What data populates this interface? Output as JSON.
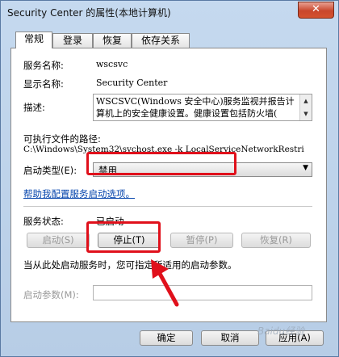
{
  "window": {
    "title": "Security Center 的属性(本地计算机)",
    "close_label": "✕"
  },
  "tabs": [
    {
      "label": "常规"
    },
    {
      "label": "登录"
    },
    {
      "label": "恢复"
    },
    {
      "label": "依存关系"
    }
  ],
  "general": {
    "service_name_label": "服务名称:",
    "service_name_value": "wscsvc",
    "display_name_label": "显示名称:",
    "display_name_value": "Security Center",
    "description_label": "描述:",
    "description_value": "WSCSVC(Windows 安全中心)服务监视并报告计\n算机上的安全健康设置。健康设置包括防火墙(",
    "exe_path_label": "可执行文件的路径:",
    "exe_path_value": "C:\\Windows\\System32\\svchost.exe -k LocalServiceNetworkRestri",
    "startup_type_label": "启动类型(E):",
    "startup_type_value": "禁用",
    "help_link": "帮助我配置服务启动选项。",
    "service_status_label": "服务状态:",
    "service_status_value": "已启动",
    "buttons": {
      "start": "启动(S)",
      "stop": "停止(T)",
      "pause": "暂停(P)",
      "resume": "恢复(R)"
    },
    "hint_text": "当从此处启动服务时，您可指定所适用的启动参数。",
    "start_params_label": "启动参数(M):",
    "start_params_value": ""
  },
  "footer": {
    "ok": "确定",
    "cancel": "取消",
    "apply": "应用(A)"
  },
  "watermark": "Baidu经验",
  "colors": {
    "annotation_red": "#e0101b",
    "link_blue": "#0645ad"
  }
}
